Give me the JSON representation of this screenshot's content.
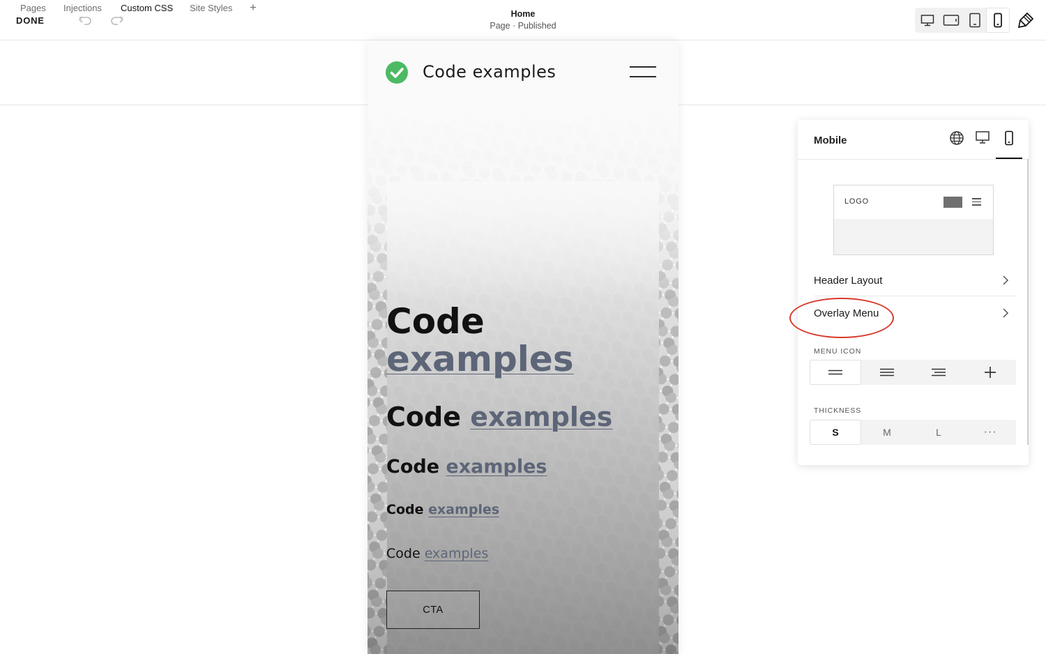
{
  "topbar": {
    "tabs": [
      "Pages",
      "Injections",
      "Custom CSS",
      "Site Styles"
    ],
    "add_label": "+",
    "done_label": "DONE",
    "page_title": "Home",
    "page_status": "Page · Published",
    "devices": [
      "desktop",
      "tablet-landscape",
      "tablet-portrait",
      "mobile"
    ],
    "selected_device": "mobile"
  },
  "site": {
    "title": "Code examples",
    "headings": [
      {
        "plain": "Code",
        "link": "examples"
      },
      {
        "plain": "Code",
        "link": "examples"
      },
      {
        "plain": "Code",
        "link": "examples"
      },
      {
        "plain": "Code",
        "link": "examples"
      },
      {
        "plain": "Code",
        "link": "examples"
      }
    ],
    "cta_label": "CTA"
  },
  "panel": {
    "title": "Mobile",
    "tab_icons": [
      "globe-icon",
      "desktop-icon",
      "mobile-icon"
    ],
    "preview": {
      "logo_text": "LOGO"
    },
    "rows": [
      "Header Layout",
      "Overlay Menu"
    ],
    "menu_icon": {
      "label": "MENU ICON",
      "options": [
        "two-lines",
        "three-lines",
        "three-lines-right",
        "plus"
      ],
      "selected": 0
    },
    "thickness": {
      "label": "THICKNESS",
      "options": [
        "S",
        "M",
        "L",
        "···"
      ],
      "selected": 0
    },
    "highlight_color": "#d9382a"
  },
  "colors": {
    "accent_check": "#4cba62",
    "link": "#5d6578"
  }
}
